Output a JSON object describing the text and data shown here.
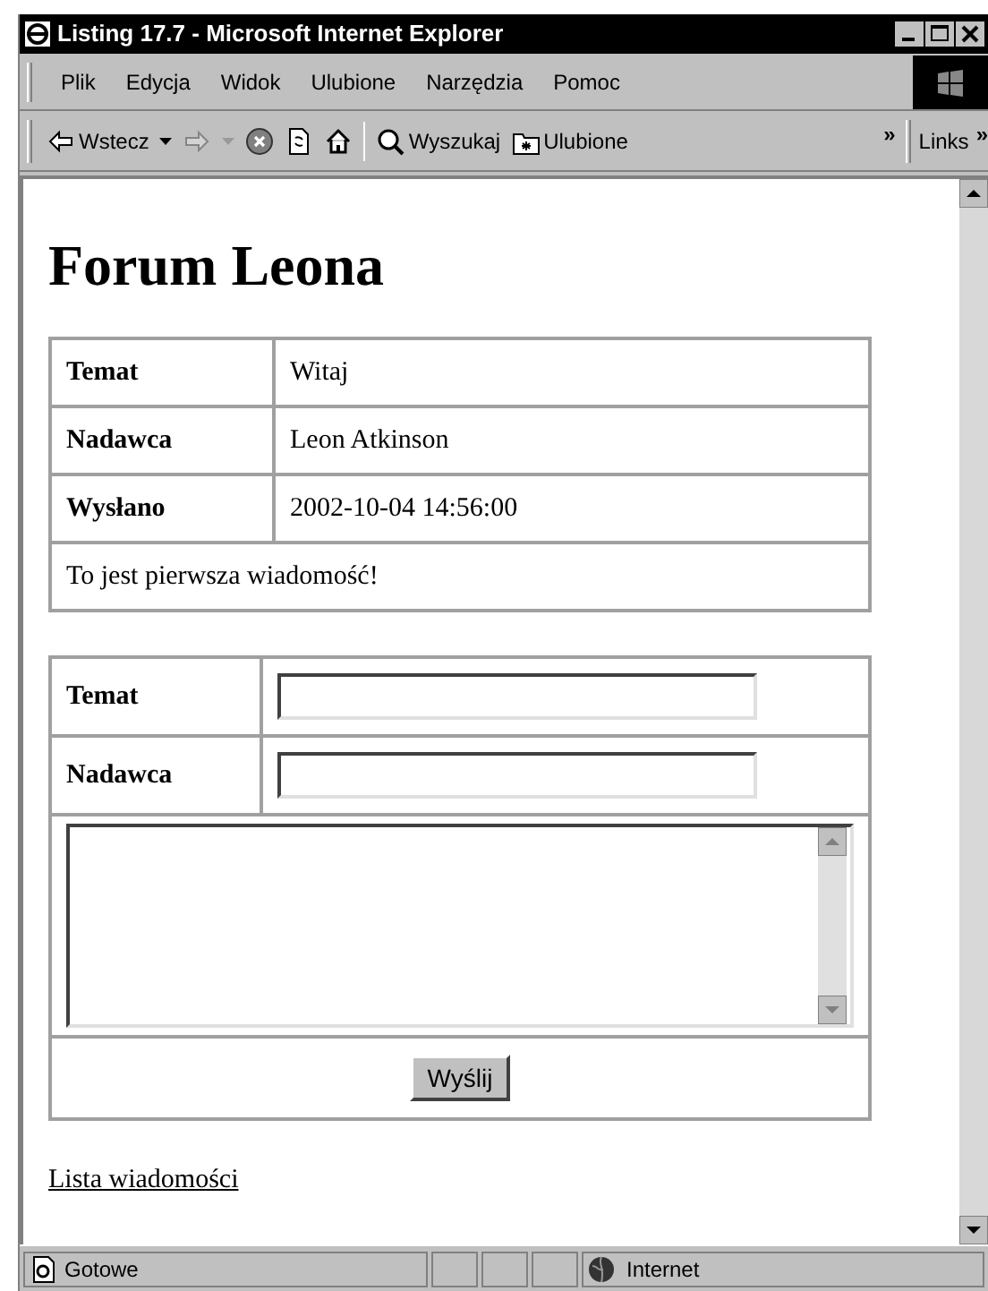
{
  "window": {
    "title": "Listing 17.7 - Microsoft Internet Explorer"
  },
  "menu": [
    "Plik",
    "Edycja",
    "Widok",
    "Ulubione",
    "Narzędzia",
    "Pomoc"
  ],
  "toolbar": {
    "buttons": [
      {
        "kind": "back",
        "label": "Wstecz",
        "disabled": false,
        "dropdown": true
      },
      {
        "kind": "forward",
        "disabled": true,
        "dropdown": true
      },
      {
        "kind": "stop",
        "disabled": false
      },
      {
        "kind": "refresh",
        "disabled": false
      },
      {
        "kind": "home",
        "disabled": false
      },
      {
        "kind": "search",
        "label": "Wyszukaj",
        "disabled": false
      },
      {
        "kind": "favorites",
        "label": "Ulubione",
        "disabled": false
      }
    ],
    "overflow": "»",
    "links": {
      "label": "Links",
      "overflow": "»"
    }
  },
  "page": {
    "heading": "Forum Leona",
    "message": {
      "rows": [
        {
          "label": "Temat",
          "value": "Witaj"
        },
        {
          "label": "Nadawca",
          "value": "Leon Atkinson"
        },
        {
          "label": "Wysłano",
          "value": "2002-10-04 14:56:00"
        }
      ],
      "body": "To jest pierwsza wiadomość!"
    },
    "form": {
      "fields": [
        {
          "label": "Temat"
        },
        {
          "label": "Nadawca"
        }
      ],
      "submit": "Wyślij"
    },
    "link": "Lista wiadomości"
  },
  "status_bar": {
    "text": "Gotowe",
    "zone": "Internet"
  }
}
